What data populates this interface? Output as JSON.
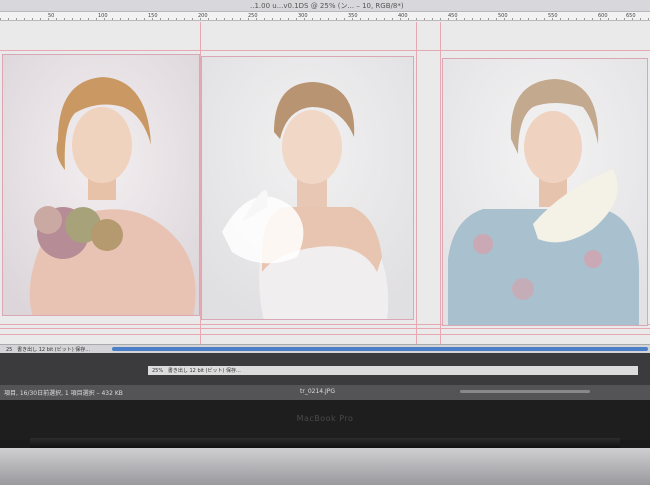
{
  "window": {
    "title": "..1.00 u...v0.1DS @ 25% (ン... – 10, RGB/8*)"
  },
  "ruler": {
    "labels": [
      "50",
      "100",
      "150",
      "200",
      "250",
      "300",
      "350",
      "400",
      "450",
      "500",
      "550",
      "600",
      "650"
    ]
  },
  "photos": [
    {
      "name": "model-1",
      "hair": "#c99863",
      "dress": "#e8c3b4",
      "bouquet": "#b68c96"
    },
    {
      "name": "model-2",
      "hair": "#b89472",
      "dress": "#f1eef0",
      "bouquet": "#ffffff"
    },
    {
      "name": "model-3",
      "hair": "#c3a98e",
      "dress": "#a9c0cf",
      "bouquet": "#f4f2e6"
    }
  ],
  "status_bar": {
    "zoom": "25",
    "doc_info": "書き出し 12 bit (ビット) 保存..."
  },
  "status_bar_secondary": {
    "zoom": "25%",
    "doc_info": "書き出し 12 bit (ビット) 保存..."
  },
  "finder_status": {
    "left_text": "項目, 16/30日前選択, 1 項目選択 – 432 KB",
    "filename": "tr_0214.JPG"
  },
  "device": {
    "brand": "MacBook Pro"
  },
  "colors": {
    "guide": "#e6a9b2",
    "scrollbar": "#4b7fc7",
    "canvas": "#ebeaea"
  }
}
